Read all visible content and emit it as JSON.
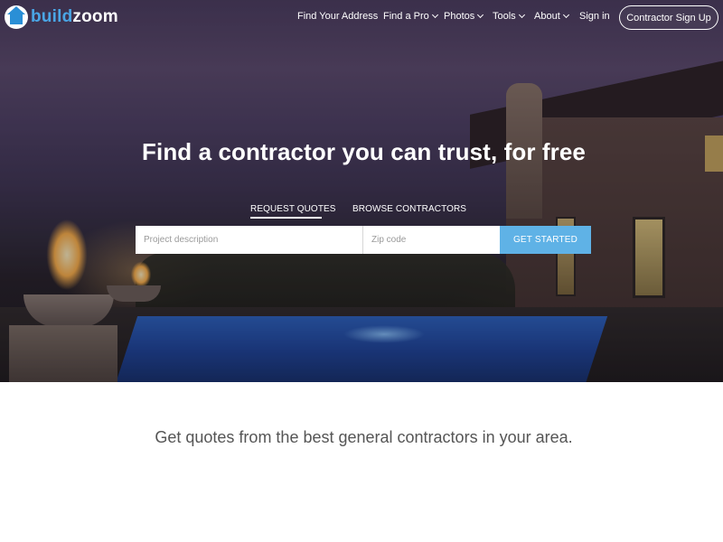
{
  "logo": {
    "part1": "build",
    "part2": "zoom"
  },
  "nav": {
    "items": [
      {
        "label": "Find Your Address",
        "has_dropdown": false
      },
      {
        "label": "Find a Pro",
        "has_dropdown": true
      },
      {
        "label": "Photos",
        "has_dropdown": true
      },
      {
        "label": "Tools",
        "has_dropdown": true
      },
      {
        "label": "About",
        "has_dropdown": true
      },
      {
        "label": "Sign in",
        "has_dropdown": false
      }
    ],
    "signup_label": "Contractor Sign Up"
  },
  "hero": {
    "headline": "Find a contractor you can trust, for free",
    "tabs": [
      {
        "label": "REQUEST QUOTES",
        "active": true
      },
      {
        "label": "BROWSE CONTRACTORS",
        "active": false
      }
    ],
    "search": {
      "project_placeholder": "Project description",
      "project_value": "",
      "zip_placeholder": "Zip code",
      "zip_value": "",
      "button_label": "GET STARTED"
    }
  },
  "tagline": "Get quotes from the best general contractors in your area.",
  "colors": {
    "accent": "#5fb2e6",
    "logo_blue": "#4aa6e6",
    "tagline_text": "#555555"
  }
}
